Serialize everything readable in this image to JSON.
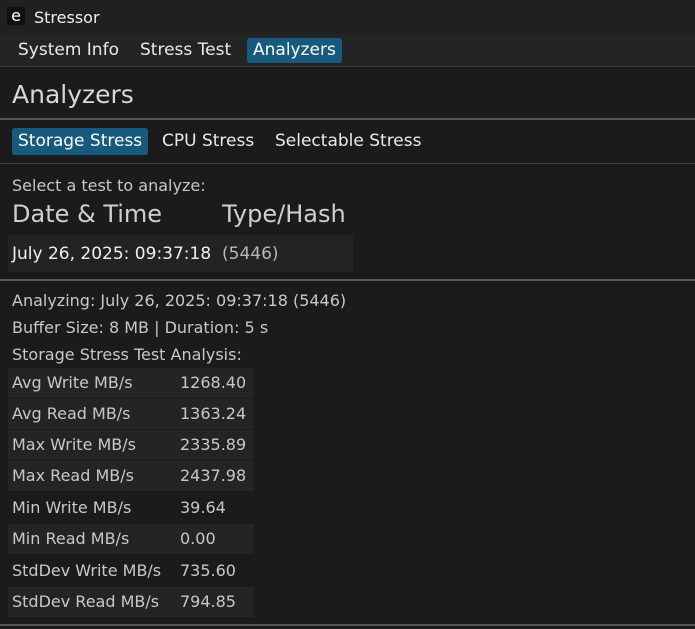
{
  "window": {
    "logo_glyph": "e",
    "title": "Stressor"
  },
  "main_tabs": [
    {
      "label": "System Info",
      "active": false
    },
    {
      "label": "Stress Test",
      "active": false
    },
    {
      "label": "Analyzers",
      "active": true
    }
  ],
  "page": {
    "heading": "Analyzers"
  },
  "sub_tabs": [
    {
      "label": "Storage Stress",
      "active": true
    },
    {
      "label": "CPU Stress",
      "active": false
    },
    {
      "label": "Selectable Stress",
      "active": false
    }
  ],
  "test_list": {
    "prompt": "Select a test to analyze:",
    "columns": [
      "Date & Time",
      "Type/Hash"
    ],
    "rows": [
      {
        "date": "July 26, 2025: 09:37:18",
        "hash": "(5446)"
      }
    ]
  },
  "analysis": {
    "analyzing": "Analyzing: July 26, 2025: 09:37:18 (5446)",
    "params": "Buffer Size: 8 MB | Duration: 5 s",
    "title": "Storage Stress Test Analysis:",
    "metrics": [
      {
        "label": "Avg Write MB/s",
        "value": "1268.40"
      },
      {
        "label": "Avg Read MB/s",
        "value": "1363.24"
      },
      {
        "label": "Max Write MB/s",
        "value": "2335.89"
      },
      {
        "label": "Max Read MB/s",
        "value": "2437.98"
      },
      {
        "label": "Min Write MB/s",
        "value": "39.64"
      },
      {
        "label": "Min Read MB/s",
        "value": "0.00"
      },
      {
        "label": "StdDev Write MB/s",
        "value": "735.60"
      },
      {
        "label": "StdDev Read MB/s",
        "value": "794.85"
      }
    ]
  },
  "colors": {
    "background": "#1b1b1b",
    "accent": "#165a80",
    "text": "#e6e6e6"
  }
}
